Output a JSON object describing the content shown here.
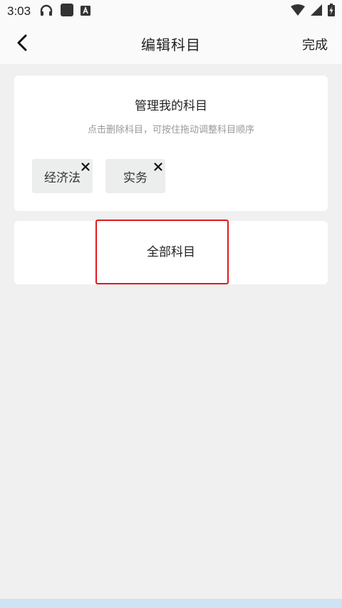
{
  "status_bar": {
    "time": "3:03",
    "icons": [
      "headphones-icon",
      "app-square-icon",
      "a-badge-icon",
      "wifi-icon",
      "signal-icon",
      "battery-charging-icon"
    ]
  },
  "app_bar": {
    "title": "编辑科目",
    "done_label": "完成",
    "back_icon": "chevron-left-icon"
  },
  "my_subjects": {
    "title": "管理我的科目",
    "subtitle": "点击删除科目，可按住拖动调整科目顺序",
    "items": [
      {
        "label": "经济法"
      },
      {
        "label": "实务"
      }
    ]
  },
  "all_subjects": {
    "title": "全部科目"
  },
  "colors": {
    "background": "#eff0ef",
    "highlight": "#e0191f",
    "chip": "#eceeed"
  }
}
